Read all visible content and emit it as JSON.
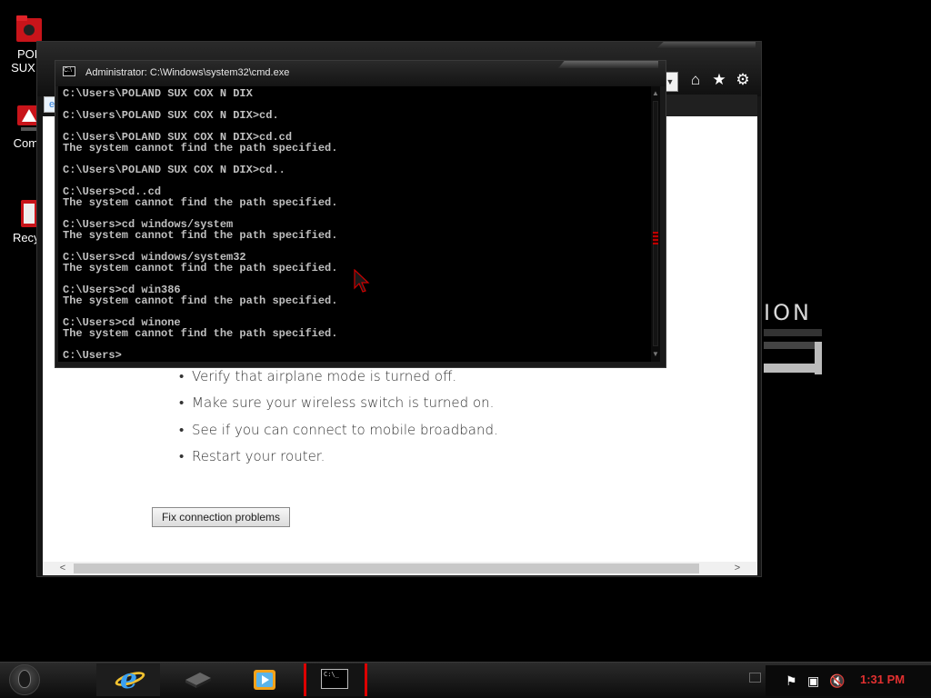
{
  "desktop": {
    "icons": [
      {
        "label": "POL\nSUX C"
      },
      {
        "label": "Comp"
      },
      {
        "label": "Recyc"
      }
    ],
    "wallpaper_text": "ION"
  },
  "browser": {
    "content": {
      "tips": [
        "Verify that airplane mode is turned off.",
        "Make sure your wireless switch is turned on.",
        "See if you can connect to mobile broadband.",
        "Restart your router."
      ],
      "fix_button_label": "Fix connection problems"
    },
    "toolbar_icons": [
      "home-icon",
      "star-icon",
      "gear-icon"
    ]
  },
  "cmd": {
    "title": "Administrator: C:\\Windows\\system32\\cmd.exe",
    "output": "C:\\Users\\POLAND SUX COX N DIX\n\nC:\\Users\\POLAND SUX COX N DIX>cd.\n\nC:\\Users\\POLAND SUX COX N DIX>cd.cd\nThe system cannot find the path specified.\n\nC:\\Users\\POLAND SUX COX N DIX>cd..\n\nC:\\Users>cd..cd\nThe system cannot find the path specified.\n\nC:\\Users>cd windows/system\nThe system cannot find the path specified.\n\nC:\\Users>cd windows/system32\nThe system cannot find the path specified.\n\nC:\\Users>cd win386\nThe system cannot find the path specified.\n\nC:\\Users>cd winone\nThe system cannot find the path specified.\n\nC:\\Users>"
  },
  "taskbar": {
    "clock": "1:31 PM",
    "accent_color": "#dd0000"
  }
}
